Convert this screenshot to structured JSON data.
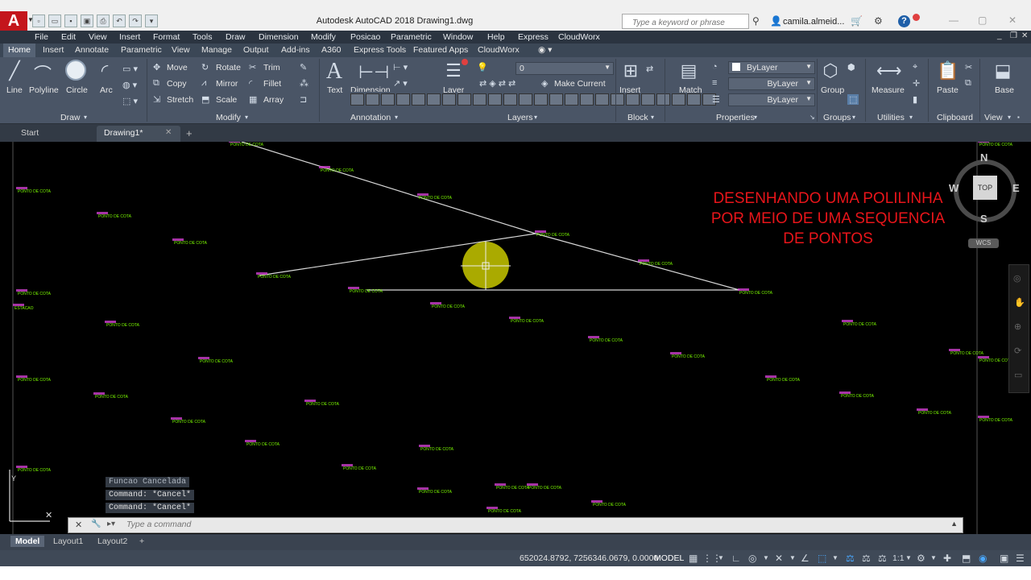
{
  "titlebar": {
    "logo": "A",
    "title": "Autodesk AutoCAD 2018   Drawing1.dwg",
    "search_placeholder": "Type a keyword or phrase",
    "user": "camila.almeid...",
    "qat_icons": [
      "new-icon",
      "open-icon",
      "save-icon",
      "save-as-icon",
      "plot-icon",
      "undo-icon",
      "redo-icon"
    ]
  },
  "menubar": {
    "items": [
      "File",
      "Edit",
      "View",
      "Insert",
      "Format",
      "Tools",
      "Draw",
      "Dimension",
      "Modify",
      "Posicao",
      "Parametric",
      "Window",
      "Help",
      "Express",
      "CloudWorx"
    ]
  },
  "ribbon_tabs": [
    "Home",
    "Insert",
    "Annotate",
    "Parametric",
    "View",
    "Manage",
    "Output",
    "Add-ins",
    "A360",
    "Express Tools",
    "Featured Apps",
    "CloudWorx"
  ],
  "ribbon": {
    "draw": {
      "title": "Draw",
      "line": "Line",
      "polyline": "Polyline",
      "circle": "Circle",
      "arc": "Arc"
    },
    "modify": {
      "title": "Modify",
      "move": "Move",
      "rotate": "Rotate",
      "trim": "Trim",
      "copy": "Copy",
      "mirror": "Mirror",
      "fillet": "Fillet",
      "stretch": "Stretch",
      "scale": "Scale",
      "array": "Array"
    },
    "annotation": {
      "title": "Annotation",
      "text": "Text",
      "dimension": "Dimension"
    },
    "layers": {
      "title": "Layers",
      "layer": "Layer",
      "layer_value": "0",
      "make_current": "Make Current"
    },
    "block": {
      "title": "Block",
      "insert": "Insert"
    },
    "properties": {
      "title": "Properties",
      "match": "Match",
      "color": "ByLayer",
      "linetype": "ByLayer",
      "lineweight": "ByLayer"
    },
    "groups": {
      "title": "Groups",
      "group": "Group"
    },
    "utilities": {
      "title": "Utilities",
      "measure": "Measure"
    },
    "clipboard": {
      "title": "Clipboard",
      "paste": "Paste"
    },
    "view": {
      "title": "View",
      "base": "Base"
    }
  },
  "filetabs": {
    "start": "Start",
    "drawing": "Drawing1*"
  },
  "canvas": {
    "annotation": "DESENHANDO UMA POLILINHA POR MEIO DE UMA SEQUENCIA DE PONTOS",
    "point_label": "PONTO DE COTA",
    "estacao_label": "ESTACAO"
  },
  "viewcube": {
    "n": "N",
    "s": "S",
    "e": "E",
    "w": "W",
    "top": "TOP",
    "wcs": "WCS"
  },
  "command": {
    "history": [
      "Funcao Cancelada",
      "Command: *Cancel*",
      "Command: *Cancel*"
    ],
    "placeholder": "Type a command"
  },
  "layout_tabs": [
    "Model",
    "Layout1",
    "Layout2"
  ],
  "statusbar": {
    "coords": "652024.8792, 7256346.0679, 0.0000",
    "model": "MODEL",
    "scale": "1:1"
  },
  "colors": {
    "accent_red": "#e8151a",
    "point_label": "#7cfc00",
    "point_marker": "#d040d0",
    "halo": "#c8c800"
  }
}
